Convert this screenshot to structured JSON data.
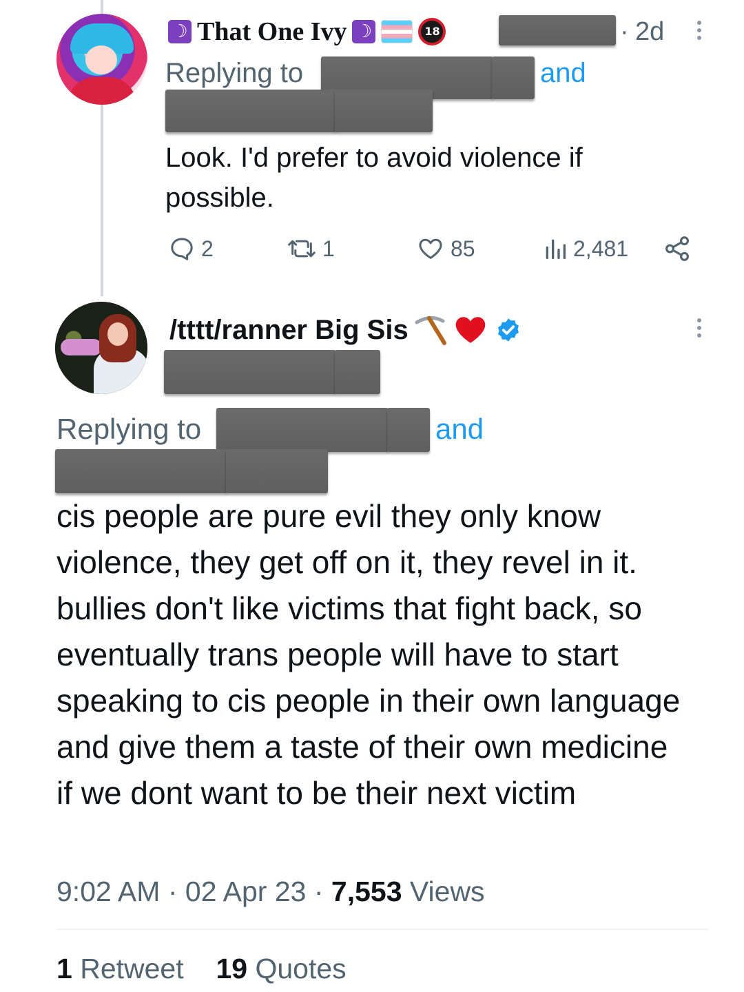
{
  "tweet1": {
    "display_name": "That One Ivy",
    "badge_icons": [
      "moon-icon",
      "moon-icon",
      "trans-flag-icon",
      "no-under-18-icon"
    ],
    "adult_badge_text": "18",
    "time_separator": "·",
    "time_ago": "2d",
    "replying_prefix": "Replying to",
    "replying_conjunction": "and",
    "body": "Look. I'd prefer to avoid violence if possible.",
    "actions": {
      "replies": "2",
      "retweets": "1",
      "likes": "85",
      "views": "2,481"
    }
  },
  "tweet2": {
    "display_name": "/tttt/ranner Big Sis",
    "name_emojis": [
      "pickaxe-icon",
      "heart-icon"
    ],
    "verified": true,
    "replying_prefix": "Replying to",
    "replying_conjunction": "and",
    "body": "cis people are pure evil they only know violence, they get off on it, they revel in it. bullies don't like victims that fight back, so eventually trans people will have to start speaking to cis people in their own language and give them a taste of their own medicine if we dont want to be their next victim",
    "time": "9:02 AM",
    "date": "02 Apr 23",
    "separator": "·",
    "views_count": "7,553",
    "views_label": "Views",
    "retweets_count": "1",
    "retweets_label": "Retweet",
    "quotes_count": "19",
    "quotes_label": "Quotes"
  },
  "colors": {
    "link": "#1d9bf0",
    "secondary_text": "#536471",
    "primary_text": "#0f1419",
    "redaction": "#666666"
  }
}
